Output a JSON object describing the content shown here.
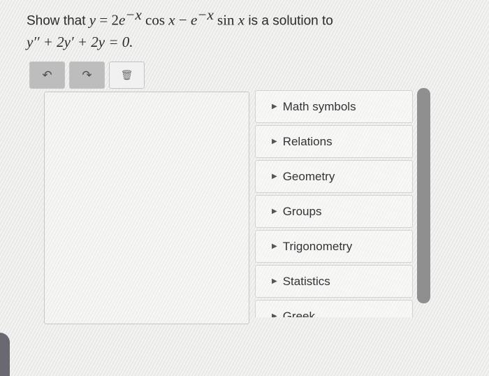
{
  "question": {
    "line1_prefix": "Show that ",
    "y": "y",
    "eq": " = 2",
    "e1": "e",
    "exp1": "−x",
    "cos": " cos ",
    "x1": "x",
    "minus": " − ",
    "e2": "e",
    "exp2": "−x",
    "sin": " sin ",
    "x2": "x",
    "line1_suffix": " is a solution to",
    "line2": "y′′ + 2y′ + 2y = 0."
  },
  "toolbar": {
    "undo_icon": "↶",
    "redo_icon": "↷",
    "delete_icon": "🗑"
  },
  "palette": {
    "items": [
      {
        "label": "Math symbols"
      },
      {
        "label": "Relations"
      },
      {
        "label": "Geometry"
      },
      {
        "label": "Groups"
      },
      {
        "label": "Trigonometry"
      },
      {
        "label": "Statistics"
      },
      {
        "label": "Greek"
      }
    ]
  }
}
